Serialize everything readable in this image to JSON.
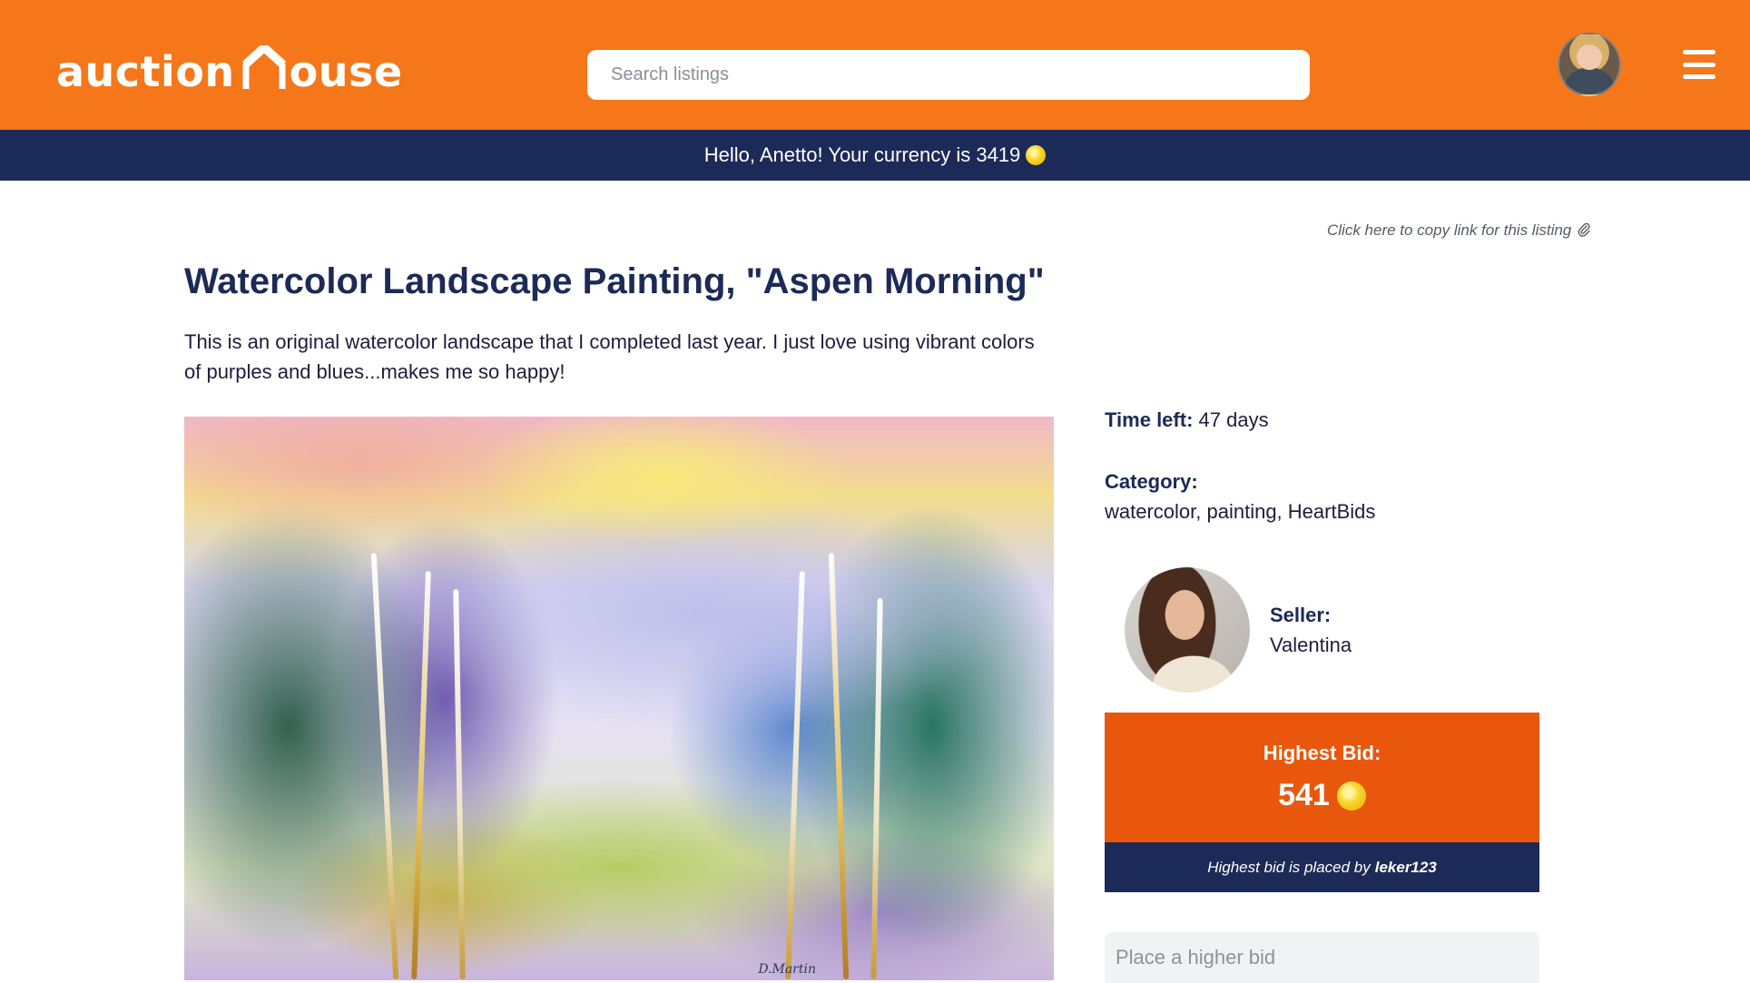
{
  "header": {
    "logo_prefix": "auction",
    "logo_suffix": "ouse",
    "search_placeholder": "Search listings",
    "brand_color": "#f67719"
  },
  "greeting": {
    "text": "Hello, Anetto! Your currency is 3419",
    "bar_color": "#1b2a57"
  },
  "listing": {
    "copy_link": "Click here to copy link for this listing",
    "title": "Watercolor Landscape Painting, \"Aspen Morning\"",
    "description": "This is an original watercolor landscape that I completed last year. I just love using vibrant colors of purples and blues...makes me so happy!",
    "painting_signature": "D.Martin"
  },
  "details": {
    "time_left_label": "Time left:",
    "time_left_value": "47 days",
    "category_label": "Category:",
    "category_value": "watercolor, painting, HeartBids",
    "seller_label": "Seller:",
    "seller_name": "Valentina"
  },
  "bid": {
    "highest_label": "Highest Bid:",
    "highest_value": "541",
    "placed_by_text": "Highest bid is placed by",
    "bidder": "leker123",
    "input_placeholder": "Place a higher bid",
    "box_color": "#e9570d"
  },
  "icons": {
    "logo": "house-icon",
    "coin": "coin-icon",
    "menu": "hamburger-menu-icon",
    "link": "paperclip-icon"
  }
}
